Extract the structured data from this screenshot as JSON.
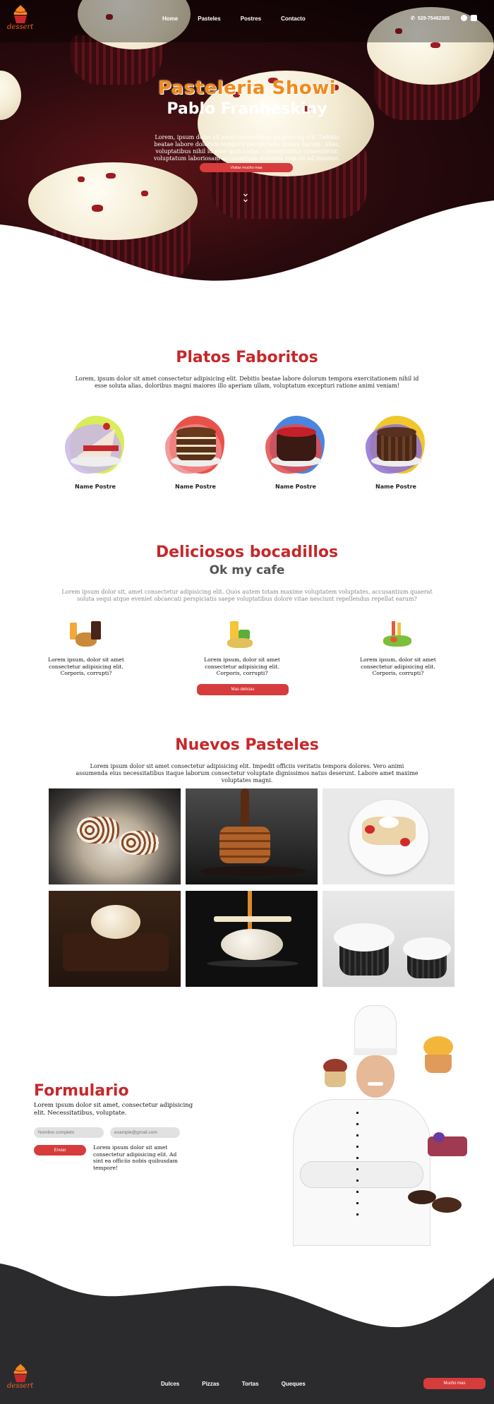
{
  "header": {
    "logo_text": "dessert",
    "nav": [
      "Home",
      "Pasteles",
      "Postres",
      "Contacto"
    ],
    "phone": "529-75482365",
    "social": [
      "facebook-icon",
      "instagram-icon"
    ]
  },
  "hero": {
    "title": "Pasteleria Showi",
    "subtitle": "Pablo Franheskiny",
    "text": "Lorem, ipsum dolor sit amet consectetur adipisicing elit. Debitis beatae labore dolorum tempora perspiciatis dolore harum. Alias, voluptatibus nihil id esse quia culpa, consequuntur consectetur, voluptatum laboriosam accusantium dolorem rem sit ad maxime.",
    "button": "Visitar mucho mas"
  },
  "favoritos": {
    "title": "Platos Faboritos",
    "text": "Lorem, ipsum dolor sit amet consectetur adipisicing elit. Debitis beatae labore dolorum tempora exercitationem nihil id esse soluta alias, doloribus magni maiores illo aperiam ullam, voluptatum excepturi ratione animi veniam!",
    "items": [
      "Name Postre",
      "Name Postre",
      "Name Postre",
      "Name Postre"
    ]
  },
  "bocadillos": {
    "title": "Deliciosos bocadillos",
    "subtitle": "Ok my cafe",
    "text": "Lorem ipsum dolor sit, amet consectetur adipisicing elit. Quos autem totam maxime voluptatem voluptates, accusantium quaerat soluta sequi atque eveniet obcaecati perspiciatis saepe voluptatibus dolore vitae nesciunt repellendus repellat earum?",
    "items": [
      "Lorem ipsum, dolor sit amet consectetur adipisicing elit. Corporis, corrupti?",
      "Lorem ipsum, dolor sit amet consectetur adipisicing elit. Corporis, corrupti?",
      "Lorem ipsum, dolor sit amet consectetur adipisicing elit. Corporis, corrupti?"
    ],
    "button": "Mas delicias"
  },
  "pasteles": {
    "title": "Nuevos Pasteles",
    "text": "Lorem ipsum dolor sit amet consectetur adipisicing elit. Impedit officiis veritatis tempora dolores. Vero animi assumenda eius necessitatibus itaque laborum consectetur voluptate dignissimos natus deserunt. Labore amet maxime voluptates magni."
  },
  "formulario": {
    "title": "Formulario",
    "text": "Lorem ipsum dolor sit amet, consectetur adipisicing elit. Necessitatibus, voluptate.",
    "name_placeholder": "Nombre completo",
    "email_placeholder": "example@gmail.com",
    "submit": "Enviar",
    "side_text": "Lorem ipsum dolor sit amet consectetur adipisicing elit. Ad sint ea officiis nobis quibusdam tempore!"
  },
  "footer": {
    "logo_text": "dessert",
    "links": [
      "Dulces",
      "Pizzas",
      "Tortas",
      "Queques"
    ],
    "button": "Mucho mas"
  },
  "colors": {
    "accent": "#d63c3c",
    "title_red": "#c6282b",
    "hero_orange": "#f08a1c",
    "footer_dark": "#2b2b2d"
  }
}
